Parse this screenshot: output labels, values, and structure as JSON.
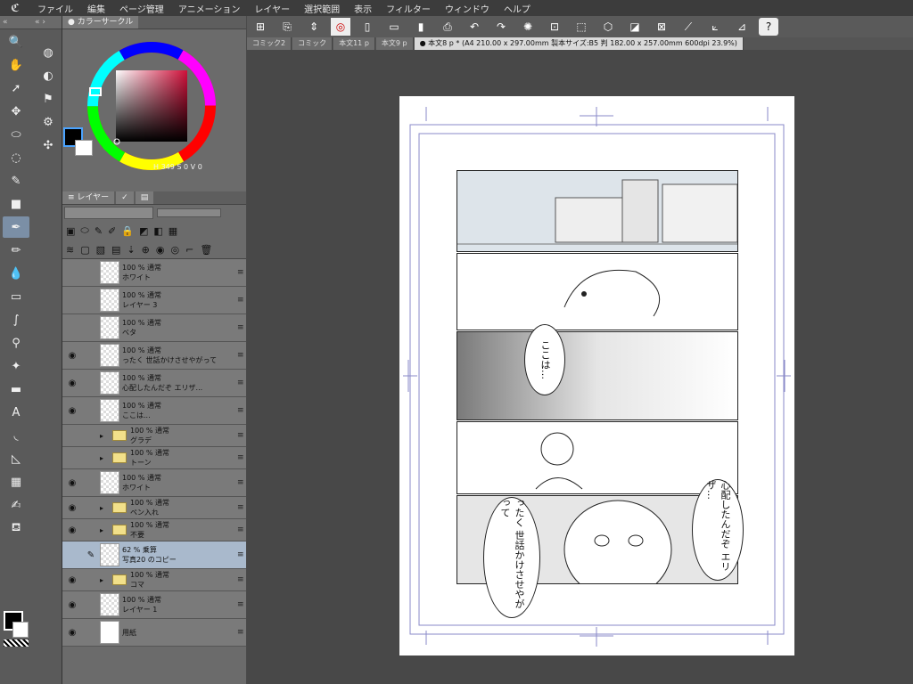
{
  "menu": [
    "ファイル",
    "編集",
    "ページ管理",
    "アニメーション",
    "レイヤー",
    "選択範囲",
    "表示",
    "フィルター",
    "ウィンドウ",
    "ヘルプ"
  ],
  "color_panel": {
    "tab": "カラーサークル",
    "h_label": "H",
    "h_value": "349",
    "s_label": "S",
    "s_value": "0",
    "v_label": "V",
    "v_value": "0"
  },
  "layer_panel": {
    "tab": "レイヤー"
  },
  "layers": [
    {
      "mode": "100 % 通常",
      "name": "ホワイト",
      "visible": false,
      "folder": false
    },
    {
      "mode": "100 % 通常",
      "name": "レイヤー 3",
      "visible": false,
      "folder": false
    },
    {
      "mode": "100 % 通常",
      "name": "ベタ",
      "visible": false,
      "folder": false
    },
    {
      "mode": "100 % 通常",
      "name": "ったく 世話かけさせやがって",
      "visible": true,
      "folder": false
    },
    {
      "mode": "100 % 通常",
      "name": "心配したんだぞ エリザ...",
      "visible": true,
      "folder": false
    },
    {
      "mode": "100 % 通常",
      "name": "ここは...",
      "visible": true,
      "folder": false
    },
    {
      "mode": "100 % 通常",
      "name": "グラデ",
      "visible": false,
      "folder": true
    },
    {
      "mode": "100 % 通常",
      "name": "トーン",
      "visible": false,
      "folder": true
    },
    {
      "mode": "100 % 通常",
      "name": "ホワイト",
      "visible": true,
      "folder": false
    },
    {
      "mode": "100 % 通常",
      "name": "ペン入れ",
      "visible": true,
      "folder": true
    },
    {
      "mode": "100 % 通常",
      "name": "不要",
      "visible": true,
      "folder": true
    },
    {
      "mode": "62 % 乗算",
      "name": "写真20 のコピー",
      "visible": false,
      "folder": false,
      "selected": true
    },
    {
      "mode": "100 % 通常",
      "name": "コマ",
      "visible": true,
      "folder": true
    },
    {
      "mode": "100 % 通常",
      "name": "レイヤー 1",
      "visible": true,
      "folder": false
    },
    {
      "mode": "",
      "name": "用紙",
      "visible": true,
      "folder": false
    }
  ],
  "doc_tabs": [
    {
      "label": "コミック2",
      "active": false
    },
    {
      "label": "コミック",
      "active": false
    },
    {
      "label": "本文11 p",
      "active": false
    },
    {
      "label": "本文9 p",
      "active": false
    },
    {
      "label": "● 本文8 p * (A4 210.00 x 297.00mm 製本サイズ:B5 判 182.00 x 257.00mm 600dpi 23.9%)",
      "active": true
    }
  ],
  "speech": {
    "bubble1": "ここは…",
    "bubble2": "心配したんだぞ エリザ…",
    "bubble3": "ったく 世話かけさせやがって"
  },
  "colors": {
    "accent": "#7b8fa6",
    "selected_layer": "#a9b9cc"
  }
}
